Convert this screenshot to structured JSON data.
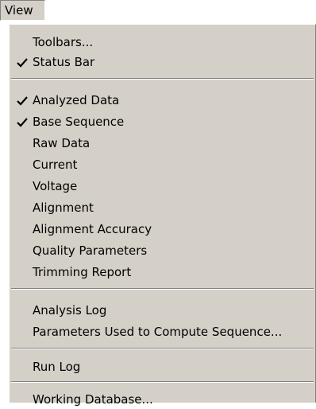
{
  "menubar": {
    "label": "View"
  },
  "menu": {
    "groups": [
      [
        {
          "label": "Toolbars...",
          "checked": false
        },
        {
          "label": "Status Bar",
          "checked": true
        }
      ],
      [
        {
          "label": "Analyzed Data",
          "checked": true
        },
        {
          "label": "Base Sequence",
          "checked": true
        },
        {
          "label": "Raw Data",
          "checked": false
        },
        {
          "label": "Current",
          "checked": false
        },
        {
          "label": "Voltage",
          "checked": false
        },
        {
          "label": "Alignment",
          "checked": false
        },
        {
          "label": "Alignment Accuracy",
          "checked": false
        },
        {
          "label": "Quality Parameters",
          "checked": false
        },
        {
          "label": "Trimming Report",
          "checked": false
        }
      ],
      [
        {
          "label": "Analysis Log",
          "checked": false
        },
        {
          "label": "Parameters Used to Compute Sequence...",
          "checked": false
        }
      ],
      [
        {
          "label": "Run Log",
          "checked": false
        }
      ],
      [
        {
          "label": "Working Database...",
          "checked": false
        }
      ]
    ]
  }
}
